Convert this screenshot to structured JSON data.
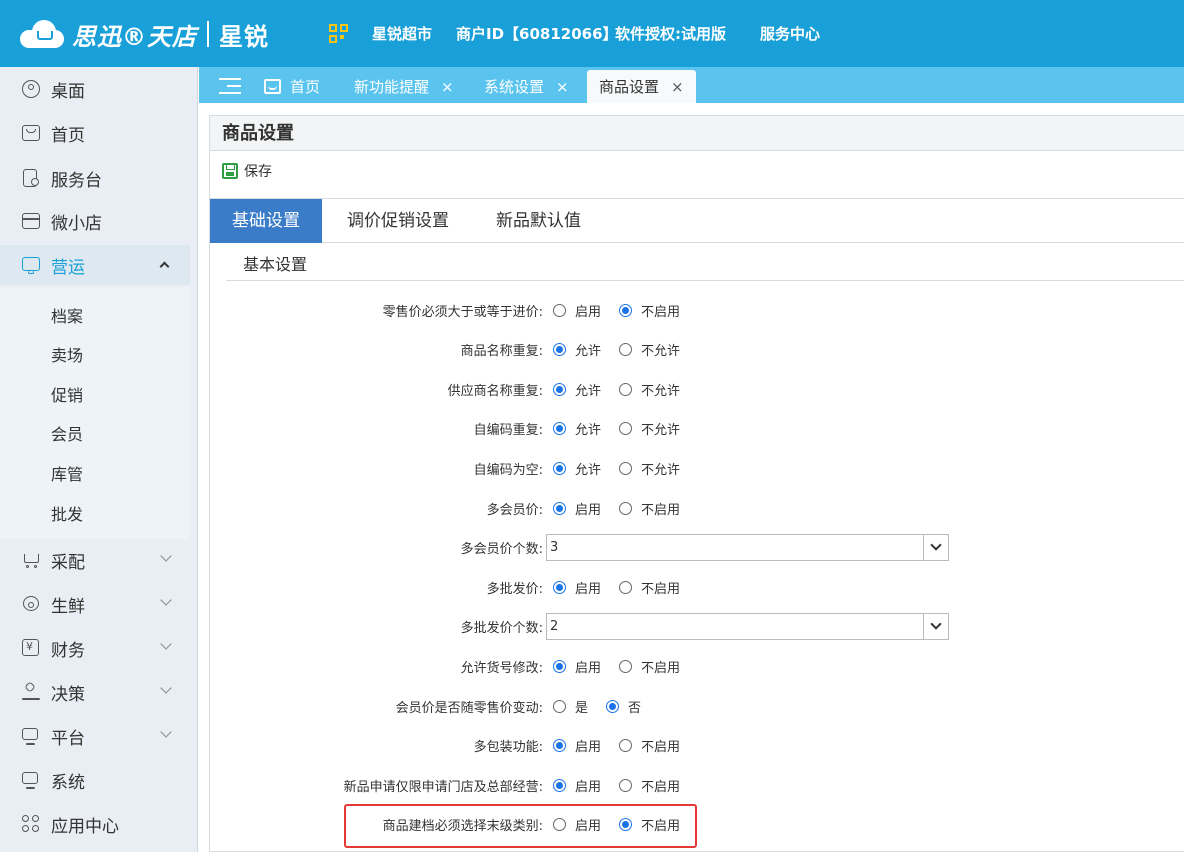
{
  "header": {
    "logo_text": "思迅®天店",
    "brand": "星锐",
    "qr_icon": "qr-code-icon",
    "store": "星锐超市",
    "merchant_id": "商户ID【60812066】",
    "license": "软件授权:试用版",
    "service": "服务中心"
  },
  "sidebar": {
    "items": [
      {
        "label": "桌面",
        "icon": "desktop-icon"
      },
      {
        "label": "首页",
        "icon": "home-icon"
      },
      {
        "label": "服务台",
        "icon": "service-desk-icon"
      },
      {
        "label": "微小店",
        "icon": "shop-icon"
      },
      {
        "label": "营运",
        "icon": "operation-chart-icon"
      },
      {
        "label": "采配",
        "icon": "cart-icon"
      },
      {
        "label": "生鲜",
        "icon": "fresh-icon"
      },
      {
        "label": "财务",
        "icon": "finance-icon"
      },
      {
        "label": "决策",
        "icon": "decision-icon"
      },
      {
        "label": "平台",
        "icon": "platform-icon"
      },
      {
        "label": "系统",
        "icon": "system-icon"
      },
      {
        "label": "应用中心",
        "icon": "app-center-icon"
      }
    ],
    "sub_items": [
      "档案",
      "卖场",
      "促销",
      "会员",
      "库管",
      "批发"
    ]
  },
  "tabs": [
    {
      "label": "首页"
    },
    {
      "label": "新功能提醒",
      "close": "×"
    },
    {
      "label": "系统设置",
      "close": "×"
    },
    {
      "label": "商品设置",
      "close": "×"
    }
  ],
  "page": {
    "title": "商品设置",
    "save_label": "保存",
    "subtabs": [
      "基础设置",
      "调价促销设置",
      "新品默认值"
    ],
    "section_title": "基本设置"
  },
  "settings": [
    {
      "label": "零售价必须大于或等于进价:",
      "opt1": "启用",
      "opt2": "不启用",
      "selected": 2
    },
    {
      "label": "商品名称重复:",
      "opt1": "允许",
      "opt2": "不允许",
      "selected": 1
    },
    {
      "label": "供应商名称重复:",
      "opt1": "允许",
      "opt2": "不允许",
      "selected": 1
    },
    {
      "label": "自编码重复:",
      "opt1": "允许",
      "opt2": "不允许",
      "selected": 1
    },
    {
      "label": "自编码为空:",
      "opt1": "允许",
      "opt2": "不允许",
      "selected": 1
    },
    {
      "label": "多会员价:",
      "opt1": "启用",
      "opt2": "不启用",
      "selected": 1
    },
    {
      "label": "多会员价个数:",
      "value": "3"
    },
    {
      "label": "多批发价:",
      "opt1": "启用",
      "opt2": "不启用",
      "selected": 1
    },
    {
      "label": "多批发价个数:",
      "value": "2"
    },
    {
      "label": "允许货号修改:",
      "opt1": "启用",
      "opt2": "不启用",
      "selected": 1
    },
    {
      "label": "会员价是否随零售价变动:",
      "opt1": "是",
      "opt2": "否",
      "selected": 2
    },
    {
      "label": "多包装功能:",
      "opt1": "启用",
      "opt2": "不启用",
      "selected": 1
    },
    {
      "label": "新品申请仅限申请门店及总部经营:",
      "opt1": "启用",
      "opt2": "不启用",
      "selected": 1
    },
    {
      "label": "商品建档必须选择末级类别:",
      "opt1": "启用",
      "opt2": "不启用",
      "selected": 2
    }
  ]
}
